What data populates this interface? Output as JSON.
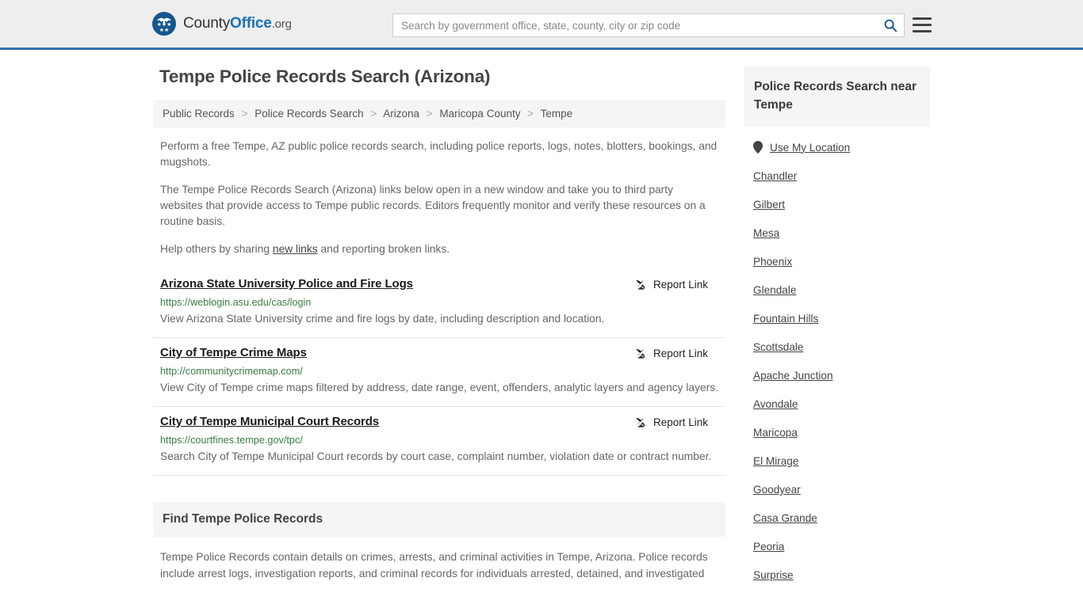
{
  "header": {
    "brand": {
      "part1": "County",
      "part2": "Office",
      "part3": ".org",
      "seal_icon": "eagle-seal-icon"
    },
    "search": {
      "placeholder": "Search by government office, state, county, city or zip code",
      "value": "",
      "search_icon": "search-icon"
    },
    "menu_icon": "hamburger-menu-icon"
  },
  "page": {
    "title": "Tempe Police Records Search (Arizona)"
  },
  "breadcrumb": {
    "items": [
      "Public Records",
      "Police Records Search",
      "Arizona",
      "Maricopa County",
      "Tempe"
    ],
    "separator": ">"
  },
  "intro": {
    "p1": "Perform a free Tempe, AZ public police records search, including police reports, logs, notes, blotters, bookings, and mugshots.",
    "p2": "The Tempe Police Records Search (Arizona) links below open in a new window and take you to third party websites that provide access to Tempe public records. Editors frequently monitor and verify these resources on a routine basis.",
    "p3_before": "Help others by sharing ",
    "p3_link": "new links",
    "p3_after": " and reporting broken links."
  },
  "results": {
    "report_label": "Report Link",
    "report_icon": "broken-link-icon",
    "items": [
      {
        "title": "Arizona State University Police and Fire Logs",
        "url": "https://weblogin.asu.edu/cas/login",
        "description": "View Arizona State University crime and fire logs by date, including description and location."
      },
      {
        "title": "City of Tempe Crime Maps",
        "url": "http://communitycrimemap.com/",
        "description": "View City of Tempe crime maps filtered by address, date range, event, offenders, analytic layers and agency layers."
      },
      {
        "title": "City of Tempe Municipal Court Records",
        "url": "https://courtfines.tempe.gov/tpc/",
        "description": "Search City of Tempe Municipal Court records by court case, complaint number, violation date or contract number."
      }
    ]
  },
  "find_section": {
    "heading": "Find Tempe Police Records",
    "body": "Tempe Police Records contain details on crimes, arrests, and criminal activities in Tempe, Arizona. Police records include arrest logs, investigation reports, and criminal records for individuals arrested, detained, and investigated"
  },
  "sidebar": {
    "heading": "Police Records Search near Tempe",
    "use_my_location": {
      "label": "Use My Location",
      "icon": "map-pin-icon"
    },
    "cities": [
      "Chandler",
      "Gilbert",
      "Mesa",
      "Phoenix",
      "Glendale",
      "Fountain Hills",
      "Scottsdale",
      "Apache Junction",
      "Avondale",
      "Maricopa",
      "El Mirage",
      "Goodyear",
      "Casa Grande",
      "Peoria",
      "Surprise"
    ]
  },
  "colors": {
    "header_bg": "#eeeeee",
    "header_border": "#2f6fa8",
    "brand_blue": "#1a73b5",
    "url_green": "#3a7d44",
    "panel_bg": "#f5f5f5",
    "text_gray": "#666666"
  }
}
